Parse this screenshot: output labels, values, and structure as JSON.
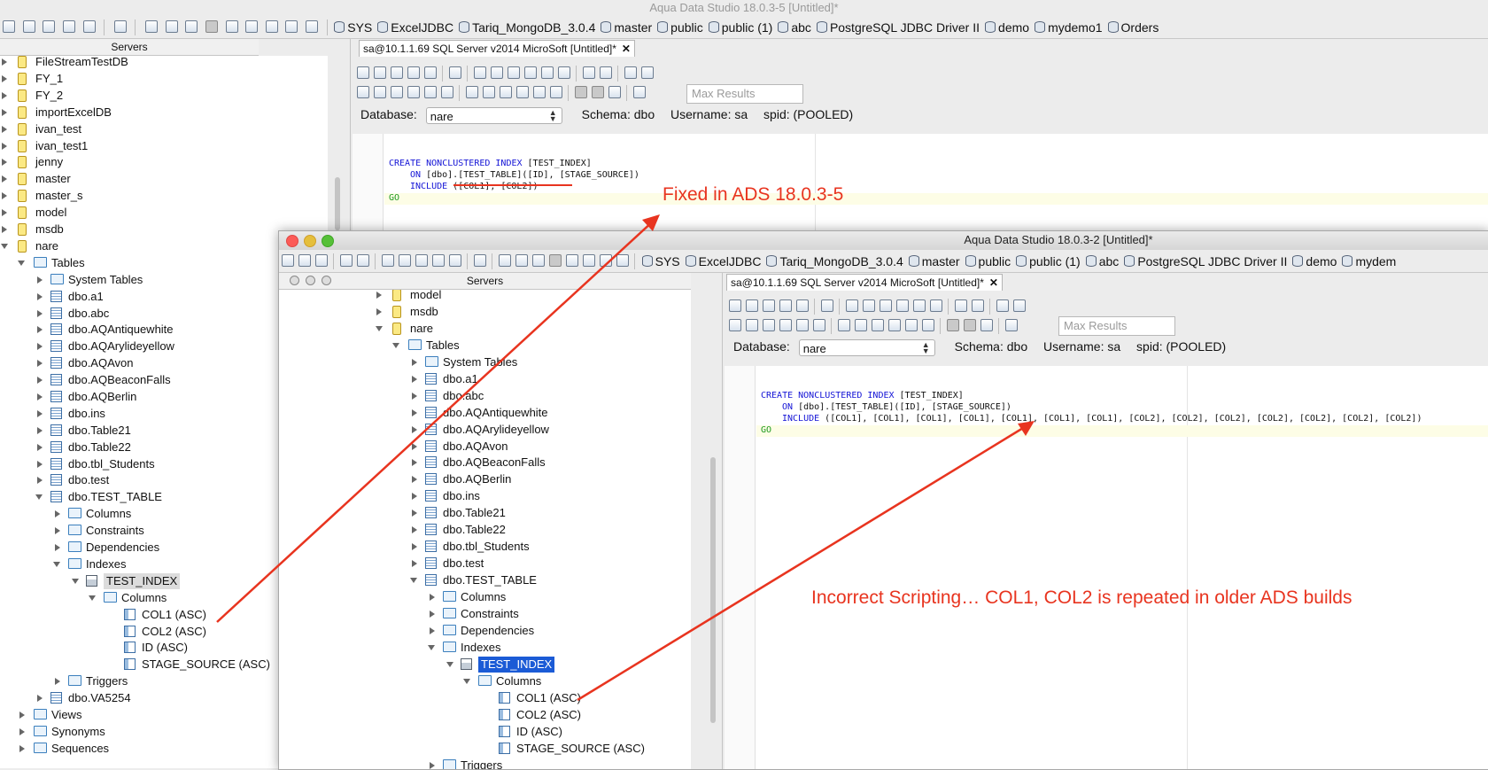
{
  "main_window": {
    "title": "Aqua Data Studio 18.0.3-5 [Untitled]*",
    "bookmarks": [
      "SYS",
      "ExcelJDBC",
      "Tariq_MongoDB_3.0.4",
      "master",
      "public",
      "public (1)",
      "abc",
      "PostgreSQL JDBC Driver II",
      "demo",
      "mydemo1",
      "Orders"
    ],
    "servers_header": "Servers",
    "tree_top": [
      "FileStreamTestDB",
      "FY_1",
      "FY_2",
      "importExcelDB",
      "ivan_test",
      "ivan_test1",
      "jenny",
      "master",
      "master_s",
      "model",
      "msdb"
    ],
    "nare": "nare",
    "tables": "Tables",
    "table_items": [
      "System Tables",
      "dbo.a1",
      "dbo.abc",
      "dbo.AQAntiquewhite",
      "dbo.AQArylideyellow",
      "dbo.AQAvon",
      "dbo.AQBeaconFalls",
      "dbo.AQBerlin",
      "dbo.ins",
      "dbo.Table21",
      "dbo.Table22",
      "dbo.tbl_Students",
      "dbo.test"
    ],
    "test_table": "dbo.TEST_TABLE",
    "test_table_children": [
      "Columns",
      "Constraints",
      "Dependencies"
    ],
    "indexes": "Indexes",
    "test_index": "TEST_INDEX",
    "columns": "Columns",
    "index_columns": [
      "COL1 (ASC)",
      "COL2 (ASC)",
      "ID (ASC)",
      "STAGE_SOURCE (ASC)"
    ],
    "triggers": "Triggers",
    "va": "dbo.VA5254",
    "bottom_items": [
      "Views",
      "Synonyms",
      "Sequences"
    ],
    "tab": "sa@10.1.1.69 SQL Server v2014 MicroSoft [Untitled]*",
    "max_results_placeholder": "Max Results",
    "database_label": "Database:",
    "database_value": "nare",
    "schema": "Schema:  dbo",
    "username": "Username:  sa",
    "spid": "spid:  (POOLED)",
    "code": {
      "l1_kw": "CREATE NONCLUSTERED INDEX",
      "l1_rest": " [TEST_INDEX]",
      "l2_kw": "ON",
      "l2_rest": " [dbo].[TEST_TABLE]([ID], [STAGE_SOURCE])",
      "l3_kw": "INCLUDE",
      "l3_rest": " ([COL1], [COL2])",
      "l4": "GO"
    }
  },
  "overlay_window": {
    "title": "Aqua Data Studio 18.0.3-2 [Untitled]*",
    "bookmarks": [
      "SYS",
      "ExcelJDBC",
      "Tariq_MongoDB_3.0.4",
      "master",
      "public",
      "public (1)",
      "abc",
      "PostgreSQL JDBC Driver II",
      "demo",
      "mydem"
    ],
    "servers_header": "Servers",
    "tree_top": [
      "model",
      "msdb"
    ],
    "nare": "nare",
    "tables": "Tables",
    "table_items": [
      "System Tables",
      "dbo.a1",
      "dbo.abc",
      "dbo.AQAntiquewhite",
      "dbo.AQArylideyellow",
      "dbo.AQAvon",
      "dbo.AQBeaconFalls",
      "dbo.AQBerlin",
      "dbo.ins",
      "dbo.Table21",
      "dbo.Table22",
      "dbo.tbl_Students",
      "dbo.test"
    ],
    "test_table": "dbo.TEST_TABLE",
    "test_table_children": [
      "Columns",
      "Constraints",
      "Dependencies"
    ],
    "indexes": "Indexes",
    "test_index": "TEST_INDEX",
    "columns": "Columns",
    "index_columns": [
      "COL1 (ASC)",
      "COL2 (ASC)",
      "ID (ASC)",
      "STAGE_SOURCE (ASC)"
    ],
    "triggers": "Triggers",
    "tab": "sa@10.1.1.69 SQL Server v2014 MicroSoft [Untitled]*",
    "max_results_placeholder": "Max Results",
    "database_label": "Database:",
    "database_value": "nare",
    "schema": "Schema:  dbo",
    "username": "Username:  sa",
    "spid": "spid:  (POOLED)",
    "code": {
      "l1_kw": "CREATE NONCLUSTERED INDEX",
      "l1_rest": " [TEST_INDEX]",
      "l2_kw": "ON",
      "l2_rest": " [dbo].[TEST_TABLE]([ID], [STAGE_SOURCE])",
      "l3_kw": "INCLUDE",
      "l3_rest": " ([COL1], [COL1], [COL1], [COL1], [COL1], [COL1], [COL1], [COL2], [COL2], [COL2], [COL2], [COL2], [COL2], [COL2])",
      "l4": "GO"
    }
  },
  "annotations": {
    "fixed": "Fixed in ADS 18.0.3-5",
    "incorrect": "Incorrect Scripting… COL1, COL2 is repeated in older ADS builds",
    "color": "#e8341f"
  }
}
